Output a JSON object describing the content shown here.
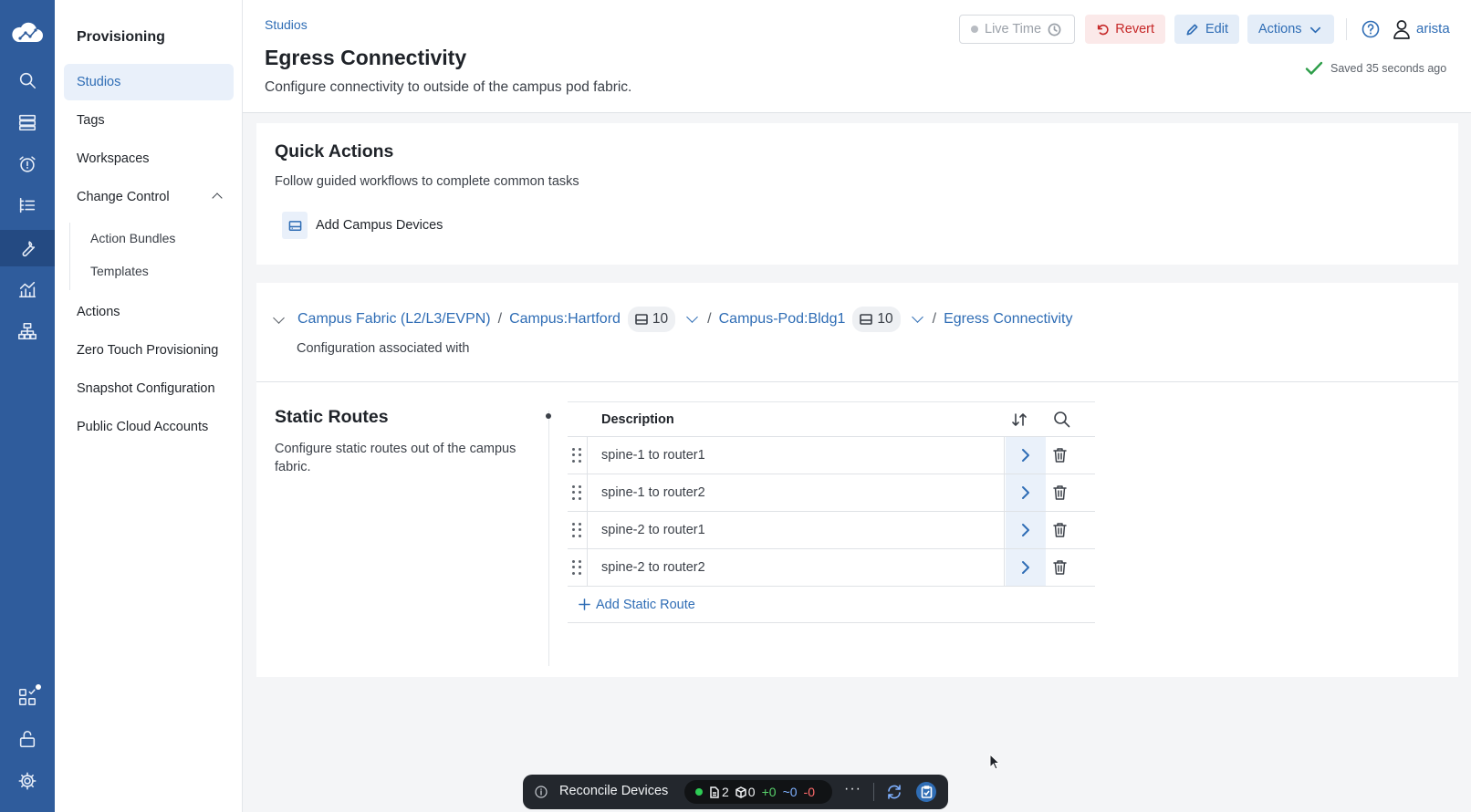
{
  "sidebar": {
    "title": "Provisioning",
    "items": [
      {
        "label": "Studios"
      },
      {
        "label": "Tags"
      },
      {
        "label": "Workspaces"
      },
      {
        "label": "Change Control"
      },
      {
        "label": "Actions"
      },
      {
        "label": "Zero Touch Provisioning"
      },
      {
        "label": "Snapshot Configuration"
      },
      {
        "label": "Public Cloud Accounts"
      }
    ],
    "change_control_sub": [
      {
        "label": "Action Bundles"
      },
      {
        "label": "Templates"
      }
    ]
  },
  "header": {
    "breadcrumb": "Studios",
    "title": "Egress Connectivity",
    "subtitle": "Configure connectivity to outside of the campus pod fabric.",
    "live_time_label": "Live Time",
    "revert_label": "Revert",
    "edit_label": "Edit",
    "actions_label": "Actions",
    "user": "arista",
    "saved_status": "Saved 35 seconds ago"
  },
  "quick_actions": {
    "title": "Quick Actions",
    "subtitle": "Follow guided workflows to complete common tasks",
    "action_label": "Add Campus Devices"
  },
  "config": {
    "breadcrumb": [
      {
        "label": "Campus Fabric (L2/L3/EVPN)"
      },
      {
        "label": "Campus:Hartford",
        "count": "10"
      },
      {
        "label": "Campus-Pod:Bldg1",
        "count": "10"
      },
      {
        "label": "Egress Connectivity"
      }
    ],
    "separator": "/",
    "associated_text": "Configuration associated with"
  },
  "static_routes": {
    "title": "Static Routes",
    "description": "Configure static routes out of the campus fabric.",
    "column_header": "Description",
    "rows": [
      {
        "description": "spine-1 to router1"
      },
      {
        "description": "spine-1 to router2"
      },
      {
        "description": "spine-2 to router1"
      },
      {
        "description": "spine-2 to router2"
      }
    ],
    "add_label": "Add Static Route"
  },
  "bottom_bar": {
    "label": "Reconcile Devices",
    "files_count": "2",
    "devices_count": "0",
    "added": "+0",
    "changed": "~0",
    "removed": "-0",
    "more": "···"
  },
  "colors": {
    "rail": "#2f5c9c",
    "accent": "#2f6db5",
    "revert": "#c62828",
    "success": "#2e9e4a"
  }
}
